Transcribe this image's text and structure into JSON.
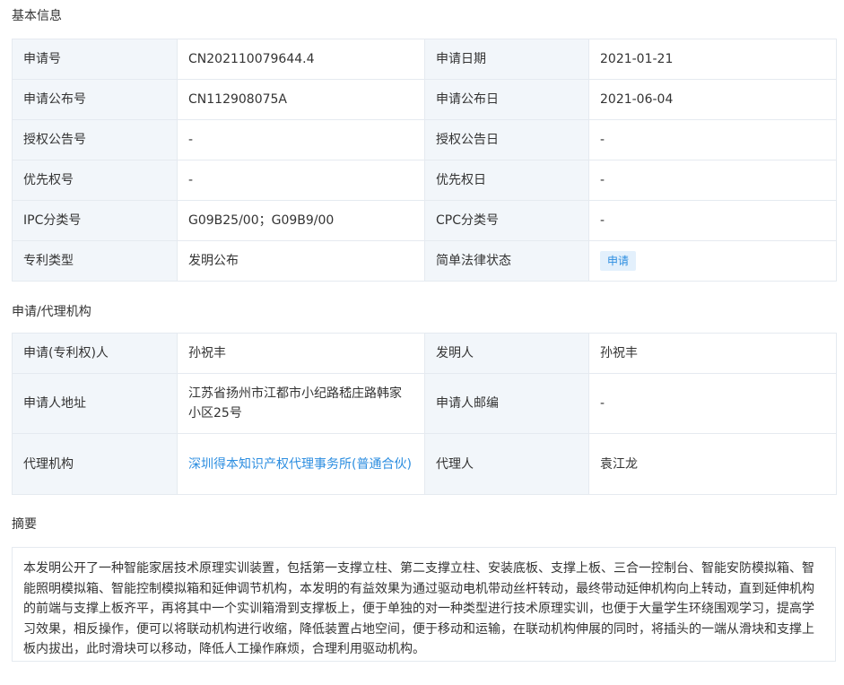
{
  "basic": {
    "title": "基本信息",
    "rows": [
      {
        "l1": "申请号",
        "v1": "CN202110079644.4",
        "l2": "申请日期",
        "v2": "2021-01-21"
      },
      {
        "l1": "申请公布号",
        "v1": "CN112908075A",
        "l2": "申请公布日",
        "v2": "2021-06-04"
      },
      {
        "l1": "授权公告号",
        "v1": "-",
        "l2": "授权公告日",
        "v2": "-"
      },
      {
        "l1": "优先权号",
        "v1": "-",
        "l2": "优先权日",
        "v2": "-"
      },
      {
        "l1": "IPC分类号",
        "v1": "G09B25/00；G09B9/00",
        "l2": "CPC分类号",
        "v2": "-"
      },
      {
        "l1": "专利类型",
        "v1": "发明公布",
        "l2": "简单法律状态",
        "v2": "申请"
      }
    ]
  },
  "agency": {
    "title": "申请/代理机构",
    "rows": [
      {
        "l1": "申请(专利权)人",
        "v1": "孙祝丰",
        "l2": "发明人",
        "v2": "孙祝丰"
      },
      {
        "l1": "申请人地址",
        "v1": "江苏省扬州市江都市小纪路嵇庄路韩家小区25号",
        "l2": "申请人邮编",
        "v2": "-"
      },
      {
        "l1": "代理机构",
        "v1": "深圳得本知识产权代理事务所(普通合伙)",
        "l2": "代理人",
        "v2": "袁江龙"
      }
    ]
  },
  "abstract": {
    "title": "摘要",
    "text": "本发明公开了一种智能家居技术原理实训装置，包括第一支撑立柱、第二支撑立柱、安装底板、支撑上板、三合一控制台、智能安防模拟箱、智能照明模拟箱、智能控制模拟箱和延伸调节机构，本发明的有益效果为通过驱动电机带动丝杆转动，最终带动延伸机构向上转动，直到延伸机构的前端与支撑上板齐平，再将其中一个实训箱滑到支撑板上，便于单独的对一种类型进行技术原理实训，也便于大量学生环绕围观学习，提高学习效果，相反操作，便可以将联动机构进行收缩，降低装置占地空间，便于移动和运输，在联动机构伸展的同时，将插头的一端从滑块和支撑上板内拔出，此时滑块可以移动，降低人工操作麻烦，合理利用驱动机构。"
  },
  "colors": {
    "label_bg": "#f2f6fa",
    "border": "#e5eaf0",
    "link": "#2d8ee0",
    "badge_bg": "#e3f0fc"
  }
}
